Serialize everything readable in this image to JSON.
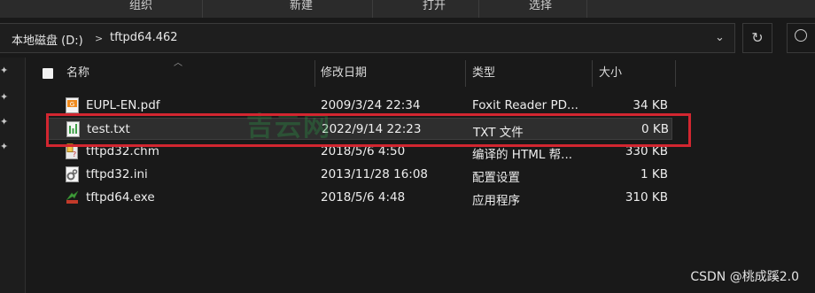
{
  "ribbon": {
    "organize": "组织",
    "new": "新建",
    "open": "打开",
    "select": "选择"
  },
  "address": {
    "drive": "本地磁盘 (D:)",
    "folder": "tftpd64.462"
  },
  "columns": {
    "name": "名称",
    "modified": "修改日期",
    "type": "类型",
    "size": "大小"
  },
  "files": [
    {
      "name": "EUPL-EN.pdf",
      "modified": "2009/3/24 22:34",
      "type": "Foxit Reader PD...",
      "size": "34 KB",
      "icon": "pdf-icon"
    },
    {
      "name": "test.txt",
      "modified": "2022/9/14 22:23",
      "type": "TXT 文件",
      "size": "0 KB",
      "icon": "txt-icon"
    },
    {
      "name": "tftpd32.chm",
      "modified": "2018/5/6 4:50",
      "type": "编译的 HTML 帮...",
      "size": "330 KB",
      "icon": "chm-icon"
    },
    {
      "name": "tftpd32.ini",
      "modified": "2013/11/28 16:08",
      "type": "配置设置",
      "size": "1 KB",
      "icon": "ini-icon"
    },
    {
      "name": "tftpd64.exe",
      "modified": "2018/5/6 4:48",
      "type": "应用程序",
      "size": "310 KB",
      "icon": "exe-icon"
    }
  ],
  "watermark": "吉云网",
  "credit": "CSDN @桃成蹊2.0",
  "colors": {
    "background": "#191919",
    "highlight_box": "#d22630",
    "selected_row": "#2e2e2e"
  }
}
